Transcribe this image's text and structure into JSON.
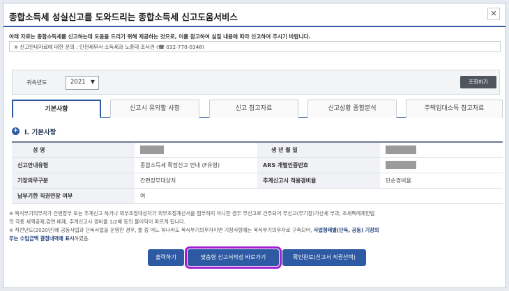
{
  "header": {
    "title": "종합소득세 성실신고를 도와드리는 종합소득세 신고도움서비스",
    "close": "✕"
  },
  "notice": "아래 자료는 종합소득세를 신고하는데 도움을 드리기 위해 제공하는 것으로, 이를 참고하여 실질 내용에 따라 신고하여 주시기 바랍니다.",
  "contact": "※ 신고안내자료에 대한 문의 : 인천세무서 소득세과 노종대 조사관 (☎ 032-770-0348)",
  "filter": {
    "label": "귀속년도",
    "year": "2021",
    "search_button": "조회하기"
  },
  "tabs": [
    {
      "label": "기본사항"
    },
    {
      "label": "신고시 유의할 사항"
    },
    {
      "label": "신고 참고자료"
    },
    {
      "label": "신고상황 종합분석"
    },
    {
      "label": "주택임대소득 참고자료"
    }
  ],
  "section": {
    "icon": "+",
    "title": "Ⅰ. 기본사항"
  },
  "info": {
    "name_label": "성 명",
    "birth_label": "생 년 월 일",
    "guide_type_label": "신고안내유형",
    "guide_type_value": "종합소득세 확정신고 안내 (F유형)",
    "ars_label": "ARS 개별인증번호",
    "bookkeeping_label": "기장의무구분",
    "bookkeeping_value": "간편장부대상자",
    "expense_rate_label": "추계신고시 적용경비율",
    "expense_rate_value": "단순경비율",
    "extension_label": "납부기한 직권연장 여부",
    "extension_value": "여"
  },
  "notes": {
    "line1": "※ 복식부기의무자가 간편장부 또는 추계신고 하거나 외부조정대상자가 외부조정계산서를 첨부하지 아니한 경우 무신고로 간주되어 무신고(무기장)가산세 부과, 조세특례제한법",
    "line2": "의 각종 세액공제,감면 배제, 추계신고시 경비율 1/2배 등의 불이익이 따르게 됩니다.",
    "line3a": "※ 직전년도(2020년)에 공동사업과 단독사업을 운영한 경우, 둘 중 어느 하나라도 복식부기의무자이면 기장사항에는 복식부기의무자로 구축되어, ",
    "line3b": "사업형태별(단독, 공동) 기장의",
    "line4a": "무는 수입금액 결정내역에 표시",
    "line4b": "하였음."
  },
  "buttons": {
    "print": "출력하기",
    "custom_report": "맞춤형 신고서작성 바로가기",
    "confirm": "확인완료(신고서 직권선택)"
  }
}
